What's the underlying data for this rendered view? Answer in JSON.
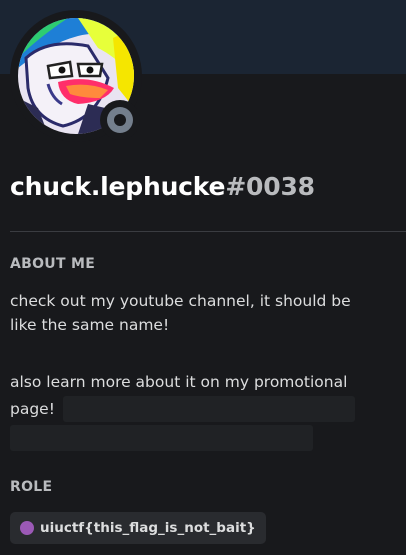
{
  "profile": {
    "username": "chuck.lephucke",
    "discriminator": "#0038",
    "status": "offline",
    "status_icon": "status-offline-icon"
  },
  "about": {
    "title": "ABOUT ME",
    "line1": "check out my youtube channel, it should be",
    "line2": "like the same name!",
    "line3": "also learn more about it on my promotional",
    "line4": "page!"
  },
  "roles": {
    "title": "ROLE",
    "items": [
      {
        "name": "uiuctf{this_flag_is_not_bait}",
        "color": "#9b59b6"
      }
    ]
  },
  "colors": {
    "background": "#18191c",
    "banner": "#1b2533",
    "status_offline": "#747f8d"
  }
}
